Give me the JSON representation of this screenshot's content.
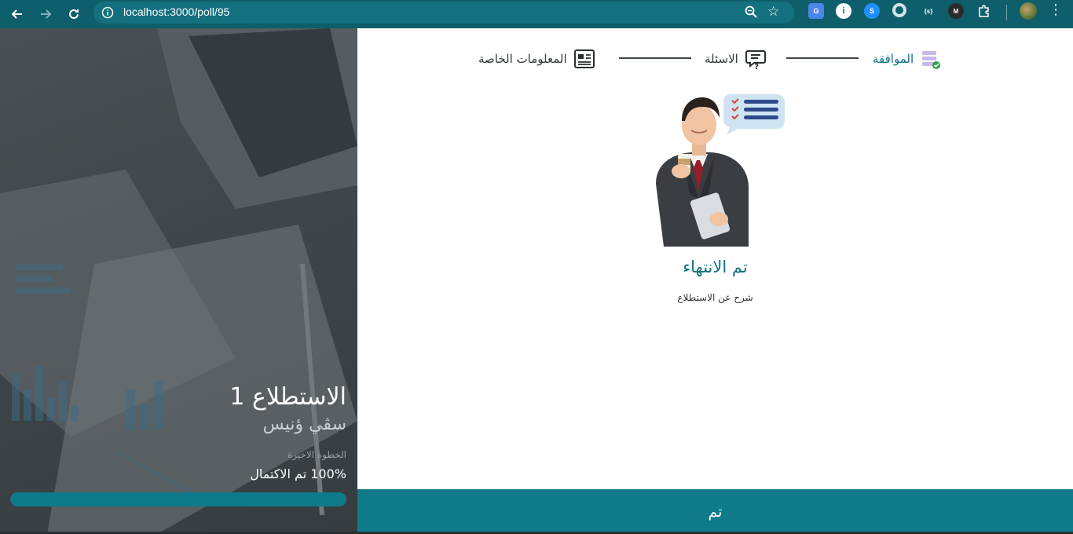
{
  "browser": {
    "url": "localhost:3000/poll/95",
    "extensions": [
      "google-translate",
      "info",
      "shazam",
      "ring",
      "sx",
      "m",
      "puzzle"
    ]
  },
  "side_panel": {
    "poll_title": "الاستطلاع 1",
    "owner_name": "سڤي ؤنيس",
    "step_label": "الخطوة الاخيرة",
    "progress_text": "100% تم الاكتمال",
    "progress_percent": 100,
    "progress_color": "#0e7a8a"
  },
  "stepper": {
    "steps": [
      {
        "label": "الموافقة",
        "icon": "database-check-icon",
        "state": "completed"
      },
      {
        "label": "الاسئلة",
        "icon": "chat-question-icon",
        "state": "default"
      },
      {
        "label": "المعلومات الخاصة",
        "icon": "newspaper-icon",
        "state": "default"
      }
    ],
    "active_color": "#0e6f80"
  },
  "completion": {
    "title": "تم الانتهاء",
    "description": "شرح عن الاستطلاع"
  },
  "footer": {
    "finish_label": "تم",
    "bar_color": "#0e7a8a"
  }
}
